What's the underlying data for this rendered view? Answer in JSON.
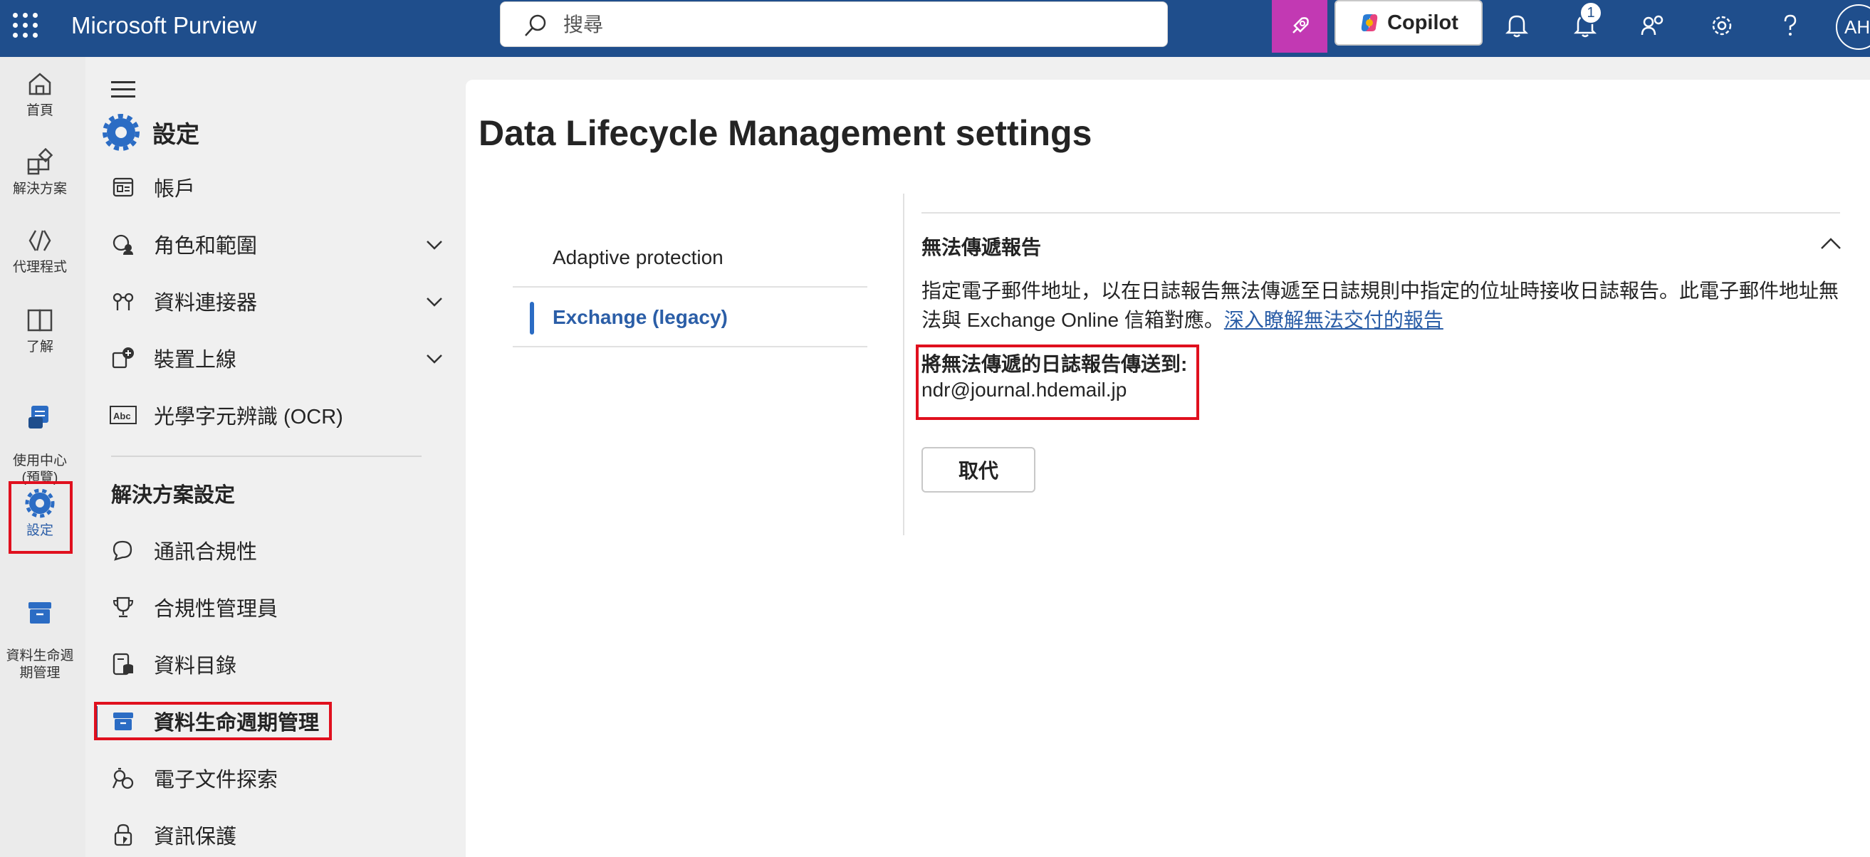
{
  "app": {
    "title": "Microsoft Purview"
  },
  "search": {
    "placeholder": "搜尋"
  },
  "header": {
    "copilot_label": "Copilot",
    "notification_count": "1",
    "avatar_initials": "AH"
  },
  "rail": {
    "items": [
      {
        "label": "首頁",
        "icon": "home-icon"
      },
      {
        "label": "解決方案",
        "icon": "solutions-icon"
      },
      {
        "label": "代理程式",
        "icon": "agents-icon"
      },
      {
        "label": "了解",
        "icon": "book-icon"
      },
      {
        "label": "使用中心\n(預覽)",
        "icon": "usage-center-icon"
      },
      {
        "label": "設定",
        "icon": "gear-icon",
        "active": true
      },
      {
        "label": "資料生命週\n期管理",
        "icon": "archive-icon"
      }
    ]
  },
  "nav": {
    "header": "設定",
    "items": [
      {
        "label": "帳戶",
        "icon": "account-icon"
      },
      {
        "label": "角色和範圍",
        "icon": "roles-icon",
        "expandable": true
      },
      {
        "label": "資料連接器",
        "icon": "connector-icon",
        "expandable": true
      },
      {
        "label": "裝置上線",
        "icon": "device-icon",
        "expandable": true
      },
      {
        "label": "光學字元辨識 (OCR)",
        "icon": "ocr-icon"
      }
    ],
    "section_title": "解決方案設定",
    "section_items": [
      {
        "label": "通訊合規性",
        "icon": "chat-icon"
      },
      {
        "label": "合規性管理員",
        "icon": "trophy-icon"
      },
      {
        "label": "資料目錄",
        "icon": "catalog-icon"
      },
      {
        "label": "資料生命週期管理",
        "icon": "archive-icon",
        "active": true
      },
      {
        "label": "電子文件探索",
        "icon": "ediscovery-icon"
      },
      {
        "label": "資訊保護",
        "icon": "lock-icon"
      }
    ]
  },
  "main": {
    "title": "Data Lifecycle Management settings",
    "subnav": [
      {
        "label": "Adaptive protection"
      },
      {
        "label": "Exchange (legacy)",
        "active": true
      }
    ],
    "section": {
      "title": "無法傳遞報告",
      "description": "指定電子郵件地址，以在日誌報告無法傳遞至日誌規則中指定的位址時接收日誌報告。此電子郵件地址無法與 Exchange Online 信箱對應。",
      "link": "深入瞭解無法交付的報告",
      "email_label": "將無法傳遞的日誌報告傳送到:",
      "email_value": "ndr@journal.hdemail.jp",
      "button": "取代"
    }
  },
  "colors": {
    "topbar": "#1f4e8c",
    "accent": "#2b6cc4",
    "highlight_border": "#e0101e",
    "copilot_tile": "#c239b3"
  }
}
